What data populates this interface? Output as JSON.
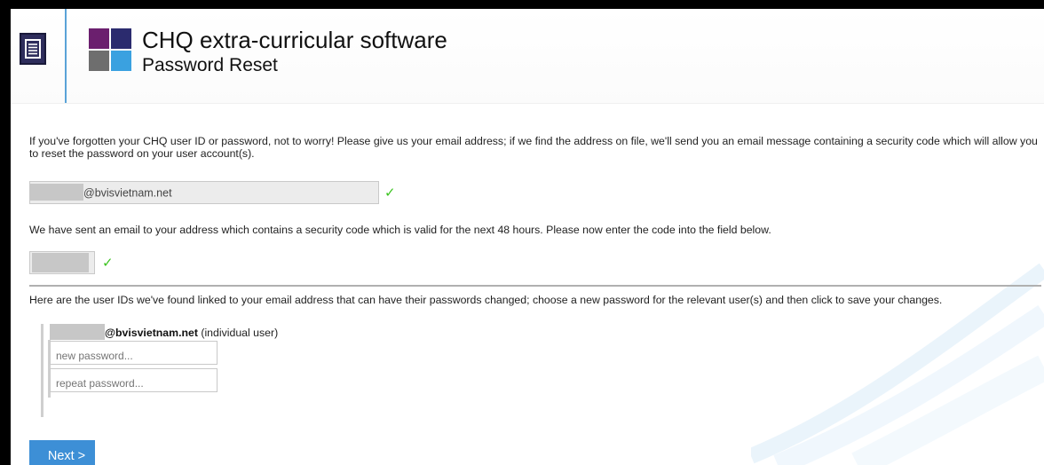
{
  "header": {
    "menu_icon": "menu-list-icon",
    "app_title": "CHQ extra-curricular software",
    "page_subtitle": "Password Reset",
    "logo_colors": [
      "#6b1f6e",
      "#2b2b6e",
      "#6e6e6e",
      "#3aa1e0"
    ]
  },
  "reset": {
    "intro_text": "If you've forgotten your CHQ user ID or password, not to worry! Please give us your email address; if we find the address on file, we'll send you an email message containing a security code which will allow you to reset the password on your user account(s).",
    "email_value": "@bvisvietnam.net",
    "email_verified_icon": "checkmark-icon",
    "sent_text": "We have sent an email to your address which contains a security code which is valid for the next 48 hours. Please now enter the code into the field below.",
    "code_verified_icon": "checkmark-icon",
    "users_intro": "Here are the user IDs we've found linked to your email address that can have their passwords changed; choose a new password for the relevant user(s) and then click to save your changes.",
    "check_glyph": "✓"
  },
  "users": [
    {
      "user_id": "@bvisvietnam.net",
      "user_type": "(individual user)",
      "new_password_placeholder": "new password...",
      "repeat_password_placeholder": "repeat password..."
    }
  ],
  "actions": {
    "next_label": "Next >"
  },
  "colors": {
    "accent": "#3d8fd6",
    "check": "#3cc420",
    "header_divider": "#5aa3d8"
  }
}
